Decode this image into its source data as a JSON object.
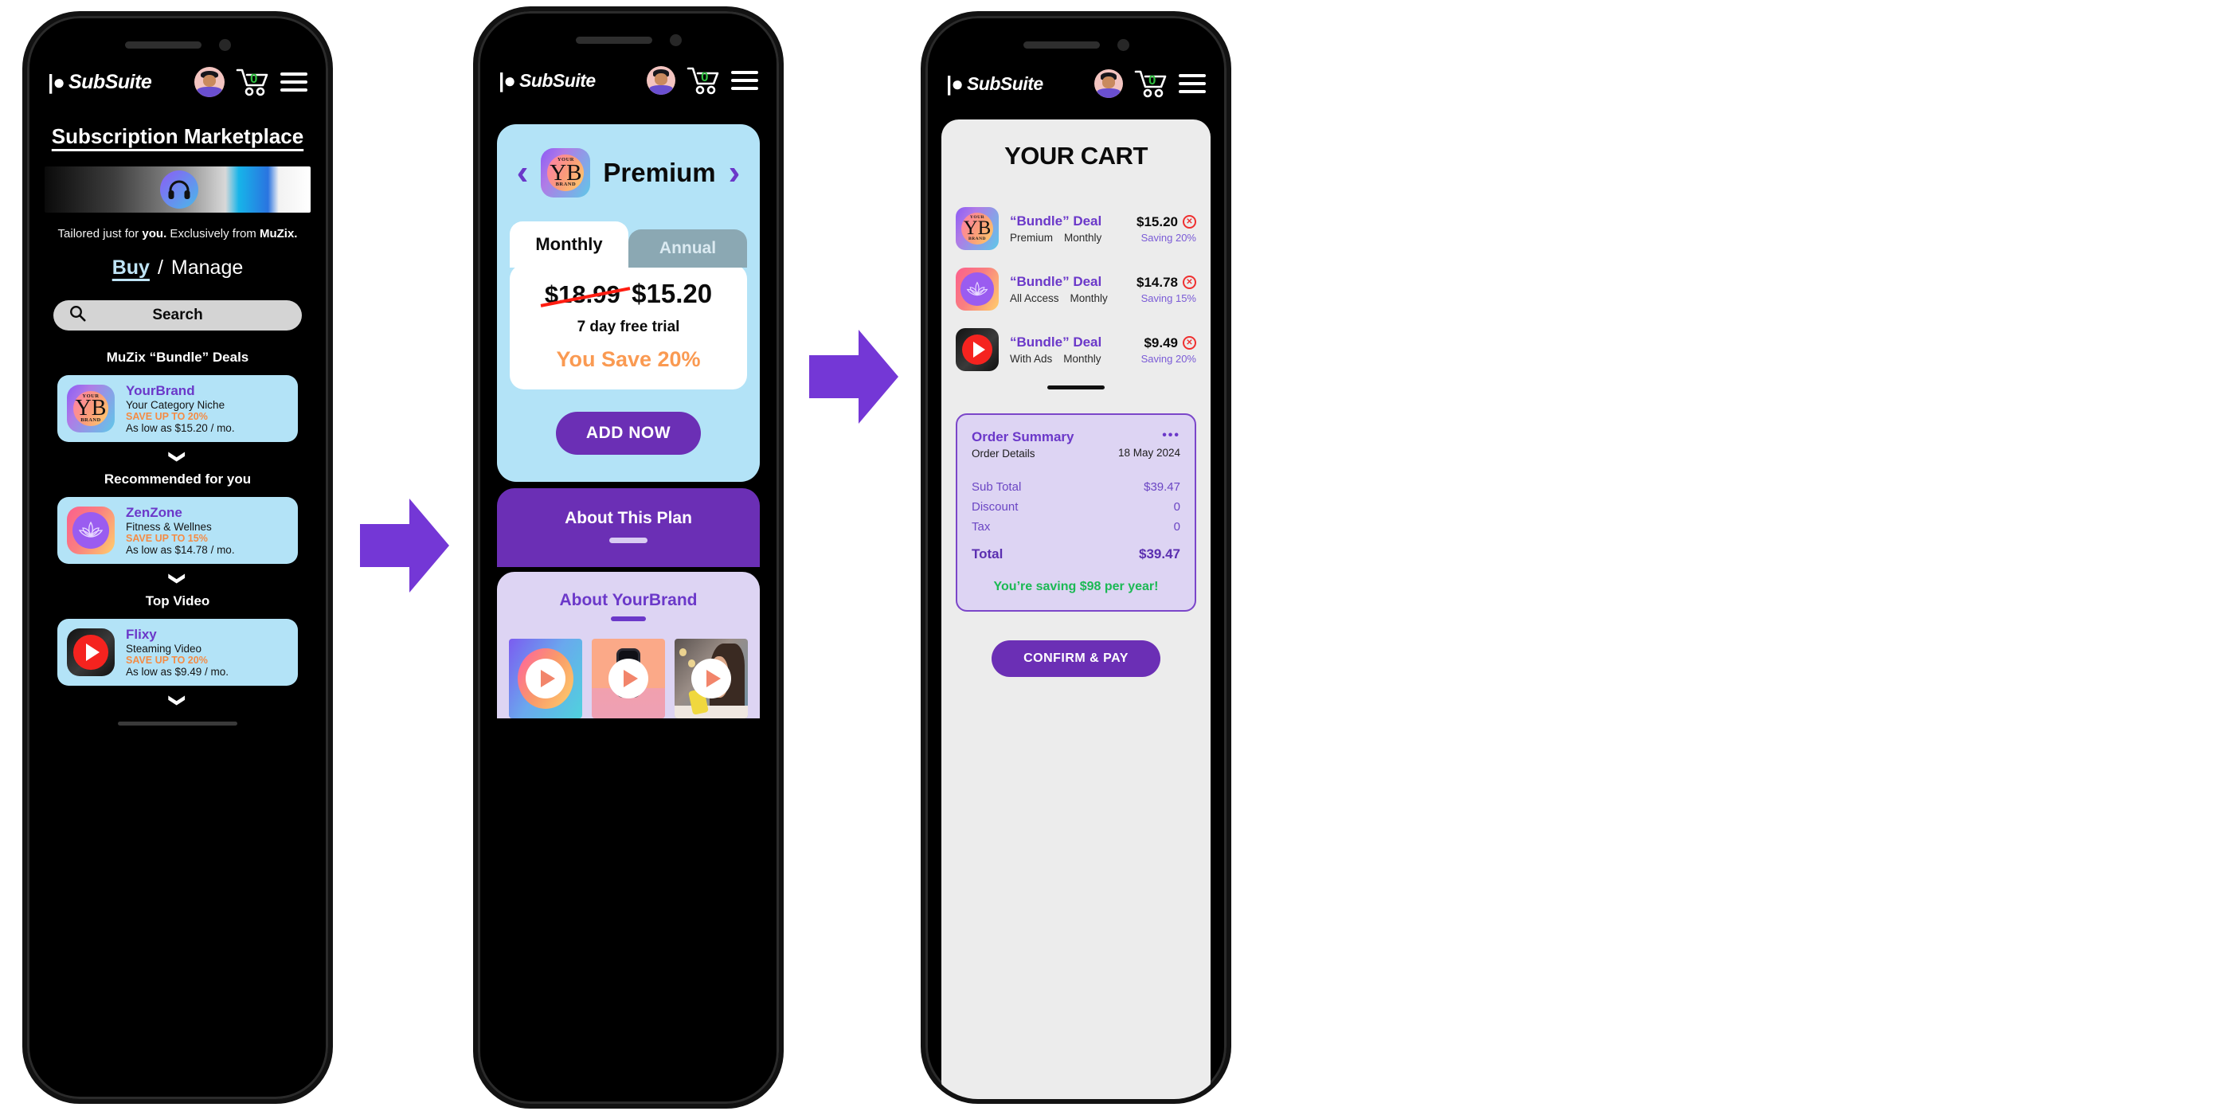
{
  "brand": {
    "logo_text": "SubSuite",
    "accent_purple": "#6b2fb5",
    "accent_blue": "#b3e3f7",
    "accent_orange": "#f58b44",
    "accent_green": "#1bb954"
  },
  "header": {
    "cart_count": "0",
    "avatar_name": "user-avatar",
    "menu_name": "hamburger-menu"
  },
  "phone1": {
    "page_title": "Subscription Marketplace",
    "banner_icon": "headphones-icon",
    "tagline_1": "Tailored just for ",
    "tagline_bold1": "you.",
    "tagline_2": " Exclusively from ",
    "tagline_bold2": "MuZix.",
    "tab_buy": "Buy",
    "tab_sep": "/",
    "tab_manage": "Manage",
    "search_placeholder": "Search",
    "sections": [
      {
        "title": "MuZix “Bundle” Deals",
        "card": {
          "name": "YourBrand",
          "category": "Your Category Niche",
          "save": "SAVE UP TO 20%",
          "price": "As low as $15.20 / mo.",
          "logo": "yourbrand-logo",
          "logo_top": "YOUR",
          "logo_bottom": "BRAND",
          "logo_mono": "YB"
        }
      },
      {
        "title": "Recommended for you",
        "card": {
          "name": "ZenZone",
          "category": "Fitness & Wellnes",
          "save": "SAVE UP TO 15%",
          "price": "As low as $14.78 / mo.",
          "logo": "lotus-logo"
        }
      },
      {
        "title": "Top Video",
        "card": {
          "name": "Flixy",
          "category": "Steaming Video",
          "save": "SAVE UP TO 20%",
          "price": "As low as $9.49 / mo.",
          "logo": "play-logo"
        }
      }
    ],
    "chevron": "❯"
  },
  "phone2": {
    "prev": "‹",
    "next": "›",
    "plan_name": "Premium",
    "tab_monthly": "Monthly",
    "tab_annual": "Annual",
    "old_price": "$18.99",
    "new_price": "$15.20",
    "trial": "7 day free trial",
    "save_line": "You Save 20%",
    "add_button": "ADD NOW",
    "about_plan": "About This Plan",
    "about_brand": "About YourBrand",
    "thumbs": [
      "thumb-brand-video",
      "thumb-phone-video",
      "thumb-lifestyle-video"
    ]
  },
  "phone3": {
    "cart_title": "YOUR CART",
    "items": [
      {
        "name": "“Bundle” Deal",
        "tier": "Premium",
        "cycle": "Monthly",
        "price": "$15.20",
        "saving": "Saving 20%",
        "logo": "yourbrand-logo",
        "remove": "✕"
      },
      {
        "name": "“Bundle” Deal",
        "tier": "All Access",
        "cycle": "Monthly",
        "price": "$14.78",
        "saving": "Saving 15%",
        "logo": "lotus-logo",
        "remove": "✕"
      },
      {
        "name": "“Bundle” Deal",
        "tier": "With Ads",
        "cycle": "Monthly",
        "price": "$9.49",
        "saving": "Saving 20%",
        "logo": "play-logo",
        "remove": "✕"
      }
    ],
    "summary": {
      "title": "Order Summary",
      "subtitle": "Order Details",
      "date": "18 May 2024",
      "menu_dots": "•••",
      "rows": [
        {
          "label": "Sub Total",
          "value": "$39.47"
        },
        {
          "label": "Discount",
          "value": "0"
        },
        {
          "label": "Tax",
          "value": "0"
        }
      ],
      "total_label": "Total",
      "total_value": "$39.47",
      "saving_note": "You’re saving $98 per year!"
    },
    "confirm_button": "CONFIRM & PAY"
  }
}
